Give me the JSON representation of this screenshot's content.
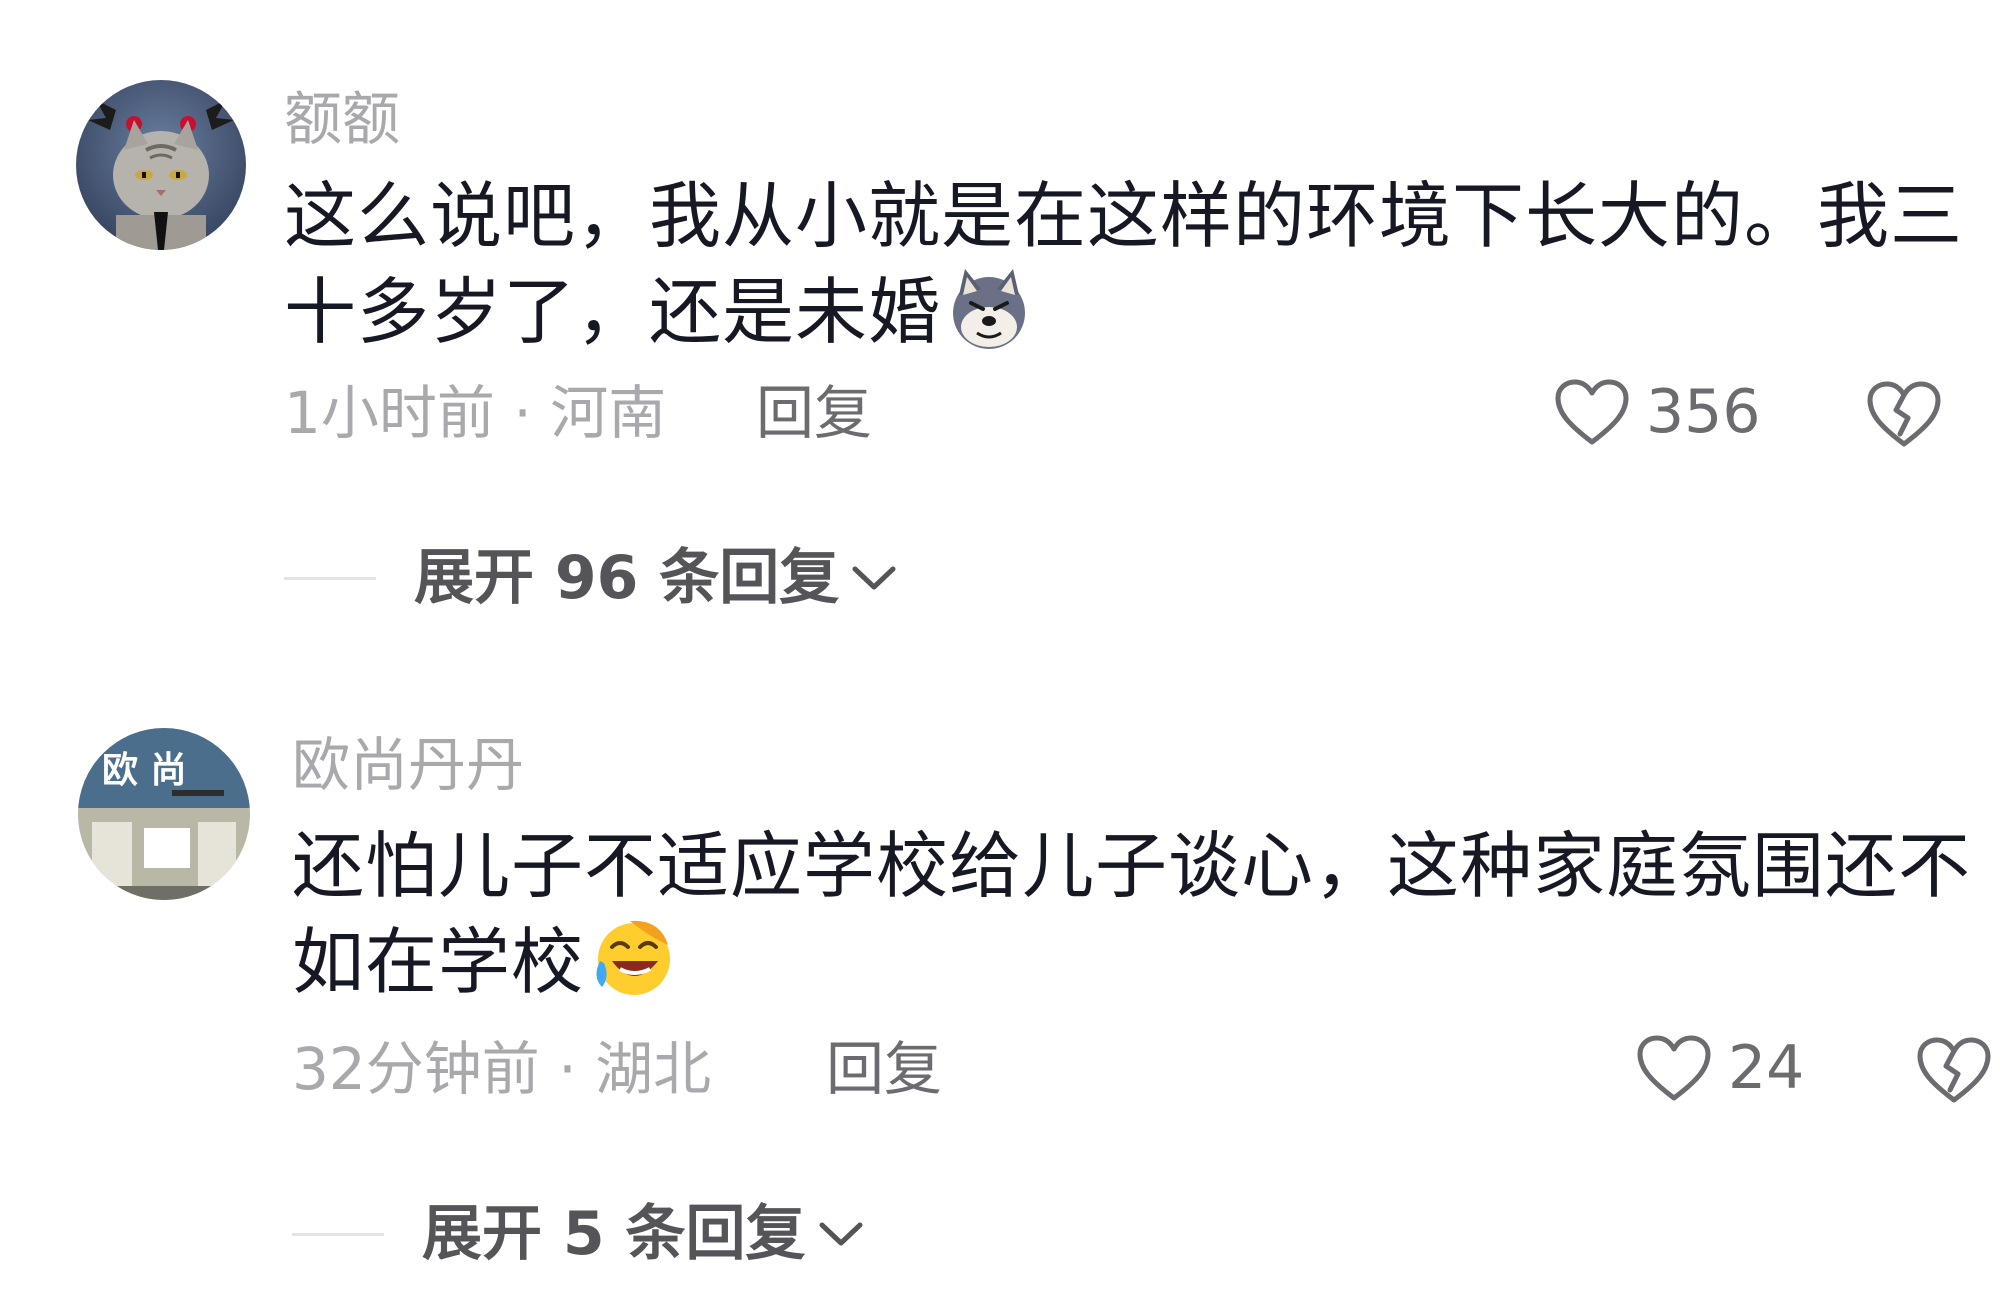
{
  "comments": [
    {
      "username": "额额",
      "avatar_icon": "cat-with-pigtails-avatar",
      "text_lines": [
        "这么说吧，我从小就是在这样的环境下长大的。我三",
        "十多岁了，还是未婚"
      ],
      "emoji_icon": "husky-dog-emoji",
      "meta": "1小时前 · 河南",
      "reply_label": "回复",
      "like_count": "356",
      "expand_label": "展开 96 条回复"
    },
    {
      "username": "欧尚丹丹",
      "avatar_icon": "store-front-avatar",
      "avatar_text": "欧 尚",
      "text_lines": [
        "还怕儿子不适应学校给儿子谈心，这种家庭氛围还不",
        "如在学校"
      ],
      "emoji_icon": "rolling-laughing-emoji",
      "meta": "32分钟前 · 湖北",
      "reply_label": "回复",
      "like_count": "24",
      "expand_label": "展开 5 条回复"
    }
  ],
  "colors": {
    "primary_text": "#161823",
    "secondary_text": "#a9a9ad",
    "action_text": "#6b6b70",
    "divider": "#e3e3e6"
  }
}
